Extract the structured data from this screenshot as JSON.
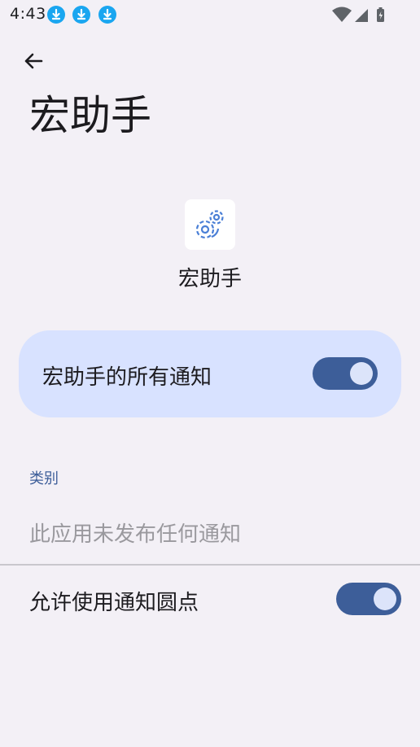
{
  "status_bar": {
    "time": "4:43",
    "icons": [
      "download-icon",
      "download-icon",
      "download-icon",
      "wifi-icon",
      "signal-icon",
      "battery-icon"
    ]
  },
  "header": {
    "back_icon": "arrow-back-icon",
    "title": "宏助手"
  },
  "app": {
    "icon": "gears-icon",
    "name": "宏助手"
  },
  "all_notifications": {
    "label": "宏助手的所有通知",
    "enabled": true
  },
  "categories": {
    "header": "类别",
    "empty_text": "此应用未发布任何通知"
  },
  "notification_dot": {
    "label": "允许使用通知圆点",
    "enabled": true
  },
  "colors": {
    "background": "#f3f0f6",
    "accent": "#3d5e99",
    "highlight": "#d8e2ff",
    "download_badge": "#1aa6f0"
  }
}
